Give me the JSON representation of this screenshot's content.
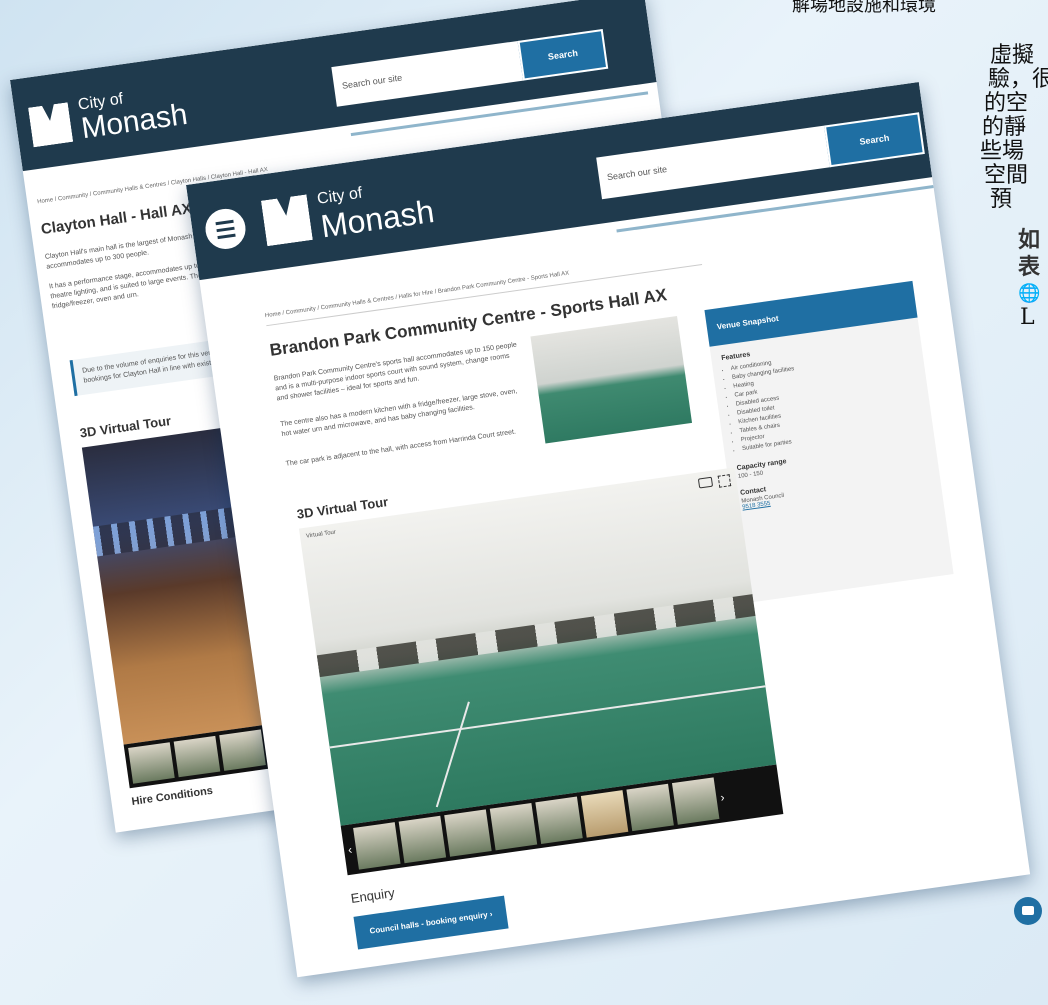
{
  "side_text": {
    "line_top": "解場地設施和環境",
    "line1": "虛擬",
    "line2": "驗，很",
    "line3": "的空",
    "line4": "的靜",
    "line5": "些場",
    "line6": "空間",
    "line7": "預",
    "bold1": "如",
    "bold2": "表",
    "globe": "🌐",
    "last": "L"
  },
  "back_page": {
    "logo_city": "City of",
    "logo_name": "Monash",
    "search_placeholder": "Search our site",
    "search_label": "Search",
    "breadcrumb": "Home  /  Community  /  Community Halls & Centres  /  Clayton Halls  /  Clayton Hall - Hall AX",
    "title": "Clayton Hall - Hall AX",
    "intro": "Clayton Hall's main hall is the largest of Monash Council's halls and accommodates up to 300 people.",
    "desc": "It has a performance stage, accommodates up to 300 people, sound system, theatre lighting, and is suited to large events. The kitchen with a dishwasher, fridge/freezer, oven and urn.",
    "notice": "Due to the volume of enquiries for this venue, Council is taking new bookings for Clayton Hall in line with existing bookings.",
    "tour_heading": "3D Virtual Tour",
    "hire_heading": "Hire Conditions"
  },
  "front_page": {
    "logo_city": "City of",
    "logo_name": "Monash",
    "search_placeholder": "Search our site",
    "search_label": "Search",
    "breadcrumb": "Home  /  Community  /  Community Halls & Centres  /  Halls for Hire  /  Brandon Park Community Centre - Sports Hall AX",
    "title": "Brandon Park Community Centre - Sports Hall AX",
    "para1": "Brandon Park Community Centre's sports hall accommodates up to 150 people and is a multi-purpose indoor sports court with sound system, change rooms and shower facilities – ideal for sports and fun.",
    "para2": "The centre also has a modern kitchen with a fridge/freezer, large stove, oven, hot water urn and microwave, and has baby changing facilities.",
    "para3": "The car park is adjacent to the hall, with access from Harrinda Court street.",
    "tour_heading": "3D Virtual Tour",
    "tour_logo": "Virtual Tour",
    "enquiry_heading": "Enquiry",
    "enquiry_button": "Council halls - booking enquiry  ›",
    "sidebar": {
      "title": "Venue Snapshot",
      "features_label": "Features",
      "features": [
        "Air conditioning",
        "Baby changing facilities",
        "Heating",
        "Car park",
        "Disabled access",
        "Disabled toilet",
        "Kitchen facilities",
        "Tables & chairs",
        "Projector",
        "Suitable for parties"
      ],
      "capacity_label": "Capacity range",
      "capacity_value": "100 - 150",
      "contact_label": "Contact",
      "contact_name": "Monash Council",
      "contact_phone": "9518 3555"
    }
  }
}
